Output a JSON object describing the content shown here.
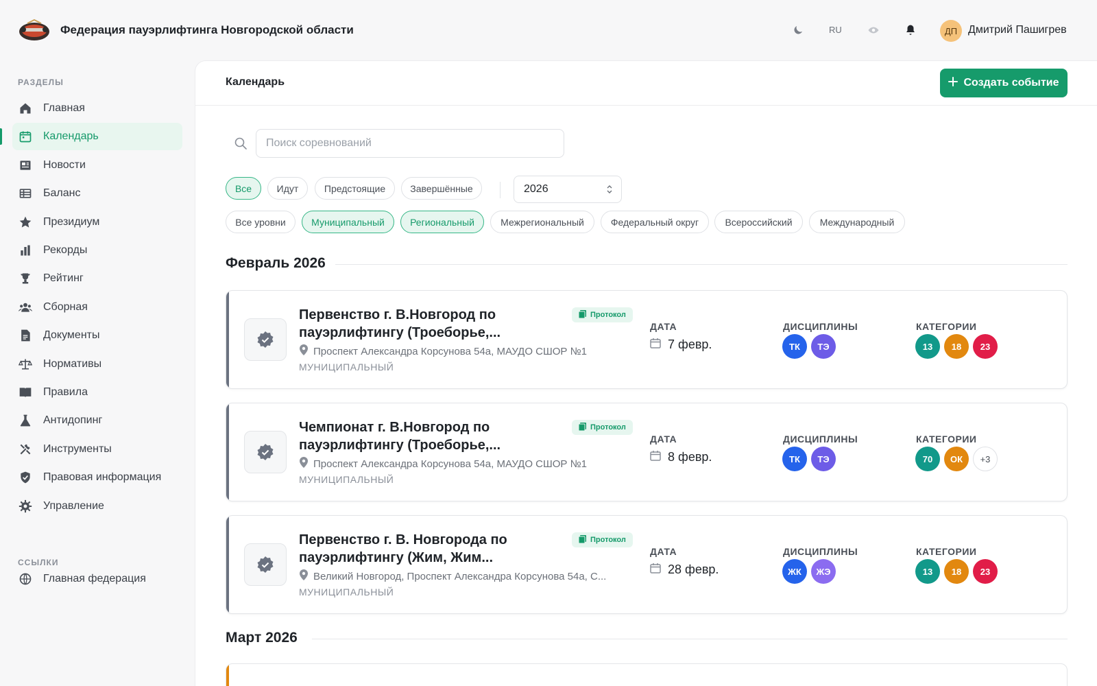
{
  "header": {
    "title": "Федерация пауэрлифтинга Новгородской области",
    "lang": "RU",
    "user_initials": "ДП",
    "user_name": "Дмитрий Пашигрев"
  },
  "sidebar": {
    "sections_title": "РАЗДЕЛЫ",
    "items": [
      {
        "label": "Главная",
        "icon": "home-icon"
      },
      {
        "label": "Календарь",
        "icon": "calendar-icon",
        "active": true
      },
      {
        "label": "Новости",
        "icon": "newspaper-icon"
      },
      {
        "label": "Баланс",
        "icon": "table-icon"
      },
      {
        "label": "Президиум",
        "icon": "star-icon"
      },
      {
        "label": "Рекорды",
        "icon": "bar-chart-icon"
      },
      {
        "label": "Рейтинг",
        "icon": "trophy-icon"
      },
      {
        "label": "Сборная",
        "icon": "users-icon"
      },
      {
        "label": "Документы",
        "icon": "document-icon"
      },
      {
        "label": "Нормативы",
        "icon": "scales-icon"
      },
      {
        "label": "Правила",
        "icon": "book-icon"
      },
      {
        "label": "Антидопинг",
        "icon": "flask-icon"
      },
      {
        "label": "Инструменты",
        "icon": "tools-icon"
      },
      {
        "label": "Правовая информация",
        "icon": "shield-icon"
      },
      {
        "label": "Управление",
        "icon": "gear-icon"
      }
    ],
    "links_title": "ССЫЛКИ",
    "links": [
      {
        "label": "Главная федерация",
        "icon": "globe-icon"
      }
    ]
  },
  "main": {
    "page_title": "Календарь",
    "create_button": "Создать событие",
    "search_placeholder": "Поиск соревнований",
    "status_filters": [
      {
        "label": "Все",
        "active": true
      },
      {
        "label": "Идут",
        "active": false
      },
      {
        "label": "Предстоящие",
        "active": false
      },
      {
        "label": "Завершённые",
        "active": false
      }
    ],
    "year": "2026",
    "level_filters": [
      {
        "label": "Все уровни",
        "active": false
      },
      {
        "label": "Муниципальный",
        "active": true
      },
      {
        "label": "Региональный",
        "active": true
      },
      {
        "label": "Межрегиональный",
        "active": false
      },
      {
        "label": "Федеральный округ",
        "active": false
      },
      {
        "label": "Всероссийский",
        "active": false
      },
      {
        "label": "Международный",
        "active": false
      }
    ],
    "col_labels": {
      "date": "ДАТА",
      "disciplines": "ДИСЦИПЛИНЫ",
      "categories": "КАТЕГОРИИ"
    },
    "months": [
      {
        "title": "Февраль 2026",
        "events": [
          {
            "title": "Первенство г. В.Новгород по пауэрлифтингу (Троеборье,...",
            "protocol": "Протокол",
            "address": "Проспект Александра Корсунова 54а, МАУДО СШОР №1",
            "level": "МУНИЦИПАЛЬНЫЙ",
            "date": "7 февр.",
            "disciplines": [
              {
                "label": "ТК",
                "color": "#2563eb"
              },
              {
                "label": "ТЭ",
                "color": "#6d5ce7"
              }
            ],
            "categories": [
              {
                "label": "13",
                "color": "#12998a"
              },
              {
                "label": "18",
                "color": "#e2880f"
              },
              {
                "label": "23",
                "color": "#e11d48"
              }
            ]
          },
          {
            "title": "Чемпионат г. В.Новгород по пауэрлифтингу (Троеборье,...",
            "protocol": "Протокол",
            "address": "Проспект Александра Корсунова 54а, МАУДО СШОР №1",
            "level": "МУНИЦИПАЛЬНЫЙ",
            "date": "8 февр.",
            "disciplines": [
              {
                "label": "ТК",
                "color": "#2563eb"
              },
              {
                "label": "ТЭ",
                "color": "#6d5ce7"
              }
            ],
            "categories": [
              {
                "label": "70",
                "color": "#12998a"
              },
              {
                "label": "ОК",
                "color": "#e2880f"
              },
              {
                "label": "+3",
                "color": "more"
              }
            ]
          },
          {
            "title": "Первенство г. В. Новгорода по пауэрлифтингу (Жим, Жим...",
            "protocol": "Протокол",
            "address": "Великий Новгород, Проспект Александра Корсунова 54а, С...",
            "level": "МУНИЦИПАЛЬНЫЙ",
            "date": "28 февр.",
            "disciplines": [
              {
                "label": "ЖК",
                "color": "#2563eb"
              },
              {
                "label": "ЖЭ",
                "color": "#8b6cf0"
              }
            ],
            "categories": [
              {
                "label": "13",
                "color": "#12998a"
              },
              {
                "label": "18",
                "color": "#e2880f"
              },
              {
                "label": "23",
                "color": "#e11d48"
              }
            ]
          }
        ]
      },
      {
        "title": "Март 2026",
        "events": []
      }
    ]
  },
  "colors": {
    "accent": "#169b6b",
    "accent_light": "#e6f6ef"
  }
}
